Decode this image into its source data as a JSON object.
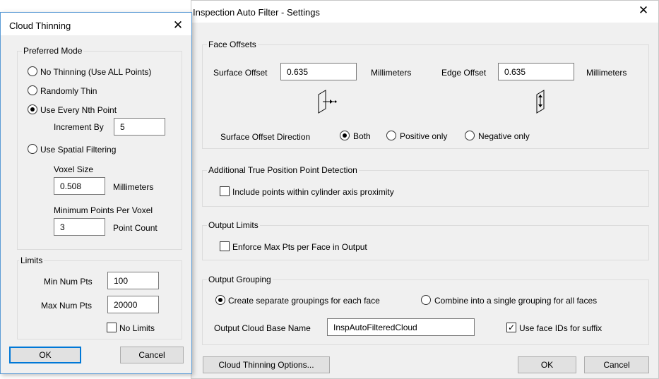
{
  "main": {
    "title": "Inspection Auto Filter - Settings",
    "close": "✕",
    "face_offsets": {
      "label": "Face Offsets",
      "surface_offset_label": "Surface Offset",
      "surface_offset_value": "0.635",
      "surface_units": "Millimeters",
      "edge_offset_label": "Edge Offset",
      "edge_offset_value": "0.635",
      "edge_units": "Millimeters",
      "direction_label": "Surface Offset Direction",
      "direction_options": [
        "Both",
        "Positive only",
        "Negative only"
      ],
      "direction_selected": "Both"
    },
    "true_position": {
      "label": "Additional True Position Point Detection",
      "checkbox_label": "Include points within cylinder axis proximity",
      "checked": false
    },
    "output_limits": {
      "label": "Output Limits",
      "checkbox_label": "Enforce Max Pts per Face in Output",
      "checked": false
    },
    "output_grouping": {
      "label": "Output Grouping",
      "options": [
        "Create separate groupings for each face",
        "Combine into a single grouping for all faces"
      ],
      "selected": "Create separate groupings for each face",
      "base_name_label": "Output Cloud Base Name",
      "base_name_value": "InspAutoFilteredCloud",
      "use_face_ids_label": "Use face IDs for suffix",
      "use_face_ids_checked": true
    },
    "buttons": {
      "thinning_options": "Cloud Thinning Options...",
      "ok": "OK",
      "cancel": "Cancel"
    }
  },
  "thinning": {
    "title": "Cloud Thinning",
    "close": "✕",
    "preferred_mode": {
      "label": "Preferred Mode",
      "options": [
        "No Thinning (Use ALL Points)",
        "Randomly Thin",
        "Use Every Nth Point",
        "Use Spatial Filtering"
      ],
      "selected": "Use Every Nth Point",
      "increment_label": "Increment By",
      "increment_value": "5",
      "voxel_size_label": "Voxel Size",
      "voxel_size_value": "0.508",
      "voxel_units": "Millimeters",
      "min_points_label": "Minimum Points Per Voxel",
      "min_points_value": "3",
      "min_points_units": "Point Count"
    },
    "limits": {
      "label": "Limits",
      "min_label": "Min Num Pts",
      "min_value": "100",
      "max_label": "Max Num Pts",
      "max_value": "20000",
      "no_limits_label": "No Limits",
      "no_limits_checked": false
    },
    "buttons": {
      "ok": "OK",
      "cancel": "Cancel"
    }
  },
  "colors": {
    "accent": "#0078d7",
    "window_bg": "#f0f0f0",
    "side_border": "#5b9bd5"
  }
}
